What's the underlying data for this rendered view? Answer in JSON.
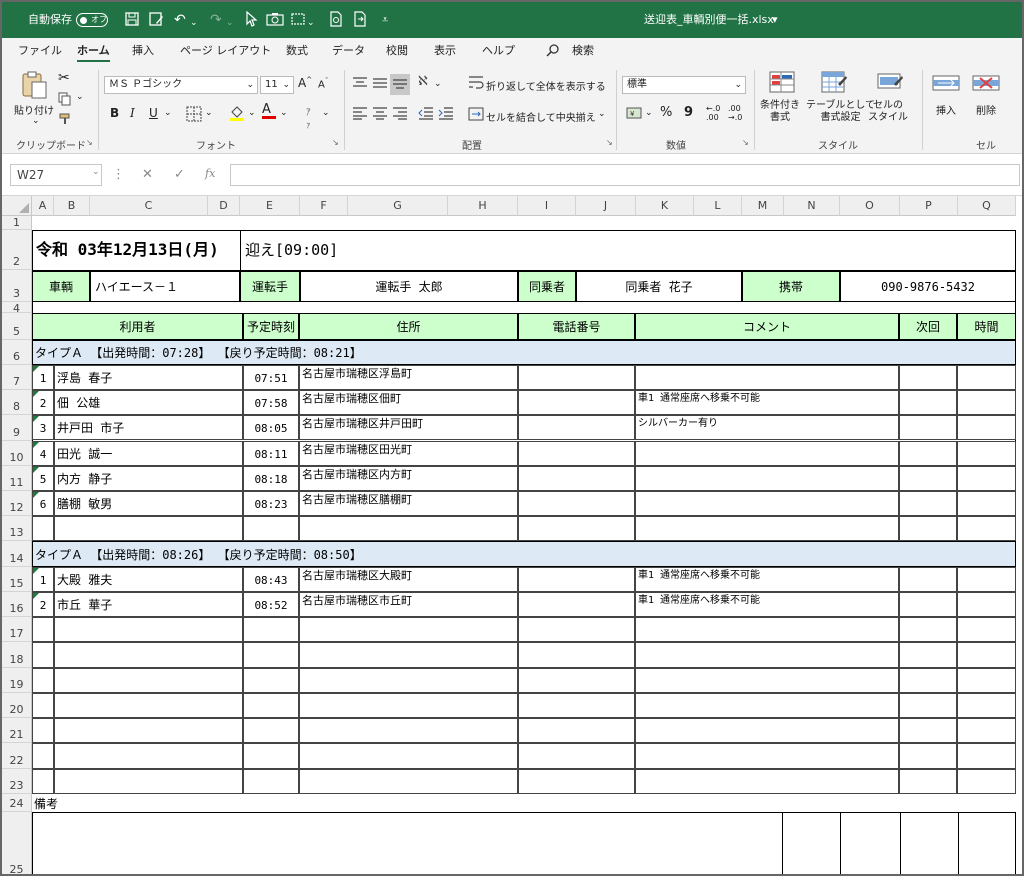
{
  "window": {
    "autosave_label": "自動保存",
    "autosave_state": "オフ",
    "filename": "送迎表_車輌別便一括.xlsx",
    "filename_dropdown": "▾"
  },
  "menu": {
    "tabs": [
      "ファイル",
      "ホーム",
      "挿入",
      "ページ レイアウト",
      "数式",
      "データ",
      "校閲",
      "表示",
      "ヘルプ"
    ],
    "search": "検索"
  },
  "ribbon": {
    "clipboard": {
      "paste": "貼り付け",
      "group": "クリップボード"
    },
    "font": {
      "name": "ＭＳ Ｐゴシック",
      "size": "11",
      "bold": "B",
      "italic": "I",
      "underline": "U",
      "group": "フォント",
      "grow": "A",
      "shrink": "A"
    },
    "align": {
      "wrap": "折り返して全体を表示する",
      "merge": "セルを結合して中央揃え",
      "group": "配置"
    },
    "number": {
      "format": "標準",
      "percent": "%",
      "comma": "9",
      "group": "数値"
    },
    "styles": {
      "conditional": "条件付き\n書式",
      "table": "テーブルとして\n書式設定",
      "cell": "セルの\nスタイル",
      "group": "スタイル"
    },
    "cells": {
      "insert": "挿入",
      "delete": "削除",
      "group": "セル"
    }
  },
  "formula_bar": {
    "name_box": "W27",
    "fx": "fx",
    "value": ""
  },
  "columns": [
    "A",
    "B",
    "C",
    "D",
    "E",
    "F",
    "G",
    "H",
    "I",
    "J",
    "K",
    "L",
    "M",
    "N",
    "O",
    "P",
    "Q"
  ],
  "rows": [
    "1",
    "2",
    "3",
    "4",
    "5",
    "6",
    "7",
    "8",
    "9",
    "10",
    "11",
    "12",
    "13",
    "14",
    "15",
    "16",
    "17",
    "18",
    "19",
    "20",
    "21",
    "22",
    "23",
    "24",
    "25"
  ],
  "sheet": {
    "date": "令和 03年12月13日(月)",
    "pickup": "迎え[09:00]",
    "vehicle_label": "車輌",
    "vehicle": "ハイエース－１",
    "driver_label": "運転手",
    "driver": "運転手 太郎",
    "companion_label": "同乗者",
    "companion": "同乗者 花子",
    "mobile_label": "携帯",
    "mobile": "090-9876-5432",
    "headers": {
      "user": "利用者",
      "time": "予定時刻",
      "address": "住所",
      "phone": "電話番号",
      "comment": "コメント",
      "next": "次回",
      "hours": "時間"
    },
    "group1": "タイプＡ 【出発時間：07:28】 【戻り予定時間：08:21】",
    "group1_rows": [
      {
        "no": "1",
        "name": "浮島 春子",
        "time": "07:51",
        "address": "名古屋市瑞穂区浮島町",
        "comment": ""
      },
      {
        "no": "2",
        "name": "佃 公雄",
        "time": "07:58",
        "address": "名古屋市瑞穂区佃町",
        "comment": "車1 通常座席へ移乗不可能"
      },
      {
        "no": "3",
        "name": "井戸田 市子",
        "time": "08:05",
        "address": "名古屋市瑞穂区井戸田町",
        "comment": "シルバーカー有り"
      },
      {
        "no": "4",
        "name": "田光 誠一",
        "time": "08:11",
        "address": "名古屋市瑞穂区田光町",
        "comment": ""
      },
      {
        "no": "5",
        "name": "内方 静子",
        "time": "08:18",
        "address": "名古屋市瑞穂区内方町",
        "comment": ""
      },
      {
        "no": "6",
        "name": "膳棚 敏男",
        "time": "08:23",
        "address": "名古屋市瑞穂区膳棚町",
        "comment": ""
      }
    ],
    "group2": "タイプＡ 【出発時間：08:26】 【戻り予定時間：08:50】",
    "group2_rows": [
      {
        "no": "1",
        "name": "大殿 雅夫",
        "time": "08:43",
        "address": "名古屋市瑞穂区大殿町",
        "comment": "車1 通常座席へ移乗不可能"
      },
      {
        "no": "2",
        "name": "市丘 華子",
        "time": "08:52",
        "address": "名古屋市瑞穂区市丘町",
        "comment": "車1 通常座席へ移乗不可能"
      }
    ],
    "remarks": "備考"
  },
  "colors": {
    "excel_green": "#217346",
    "header_green": "#ccffcc",
    "group_blue": "#dde9f5"
  }
}
